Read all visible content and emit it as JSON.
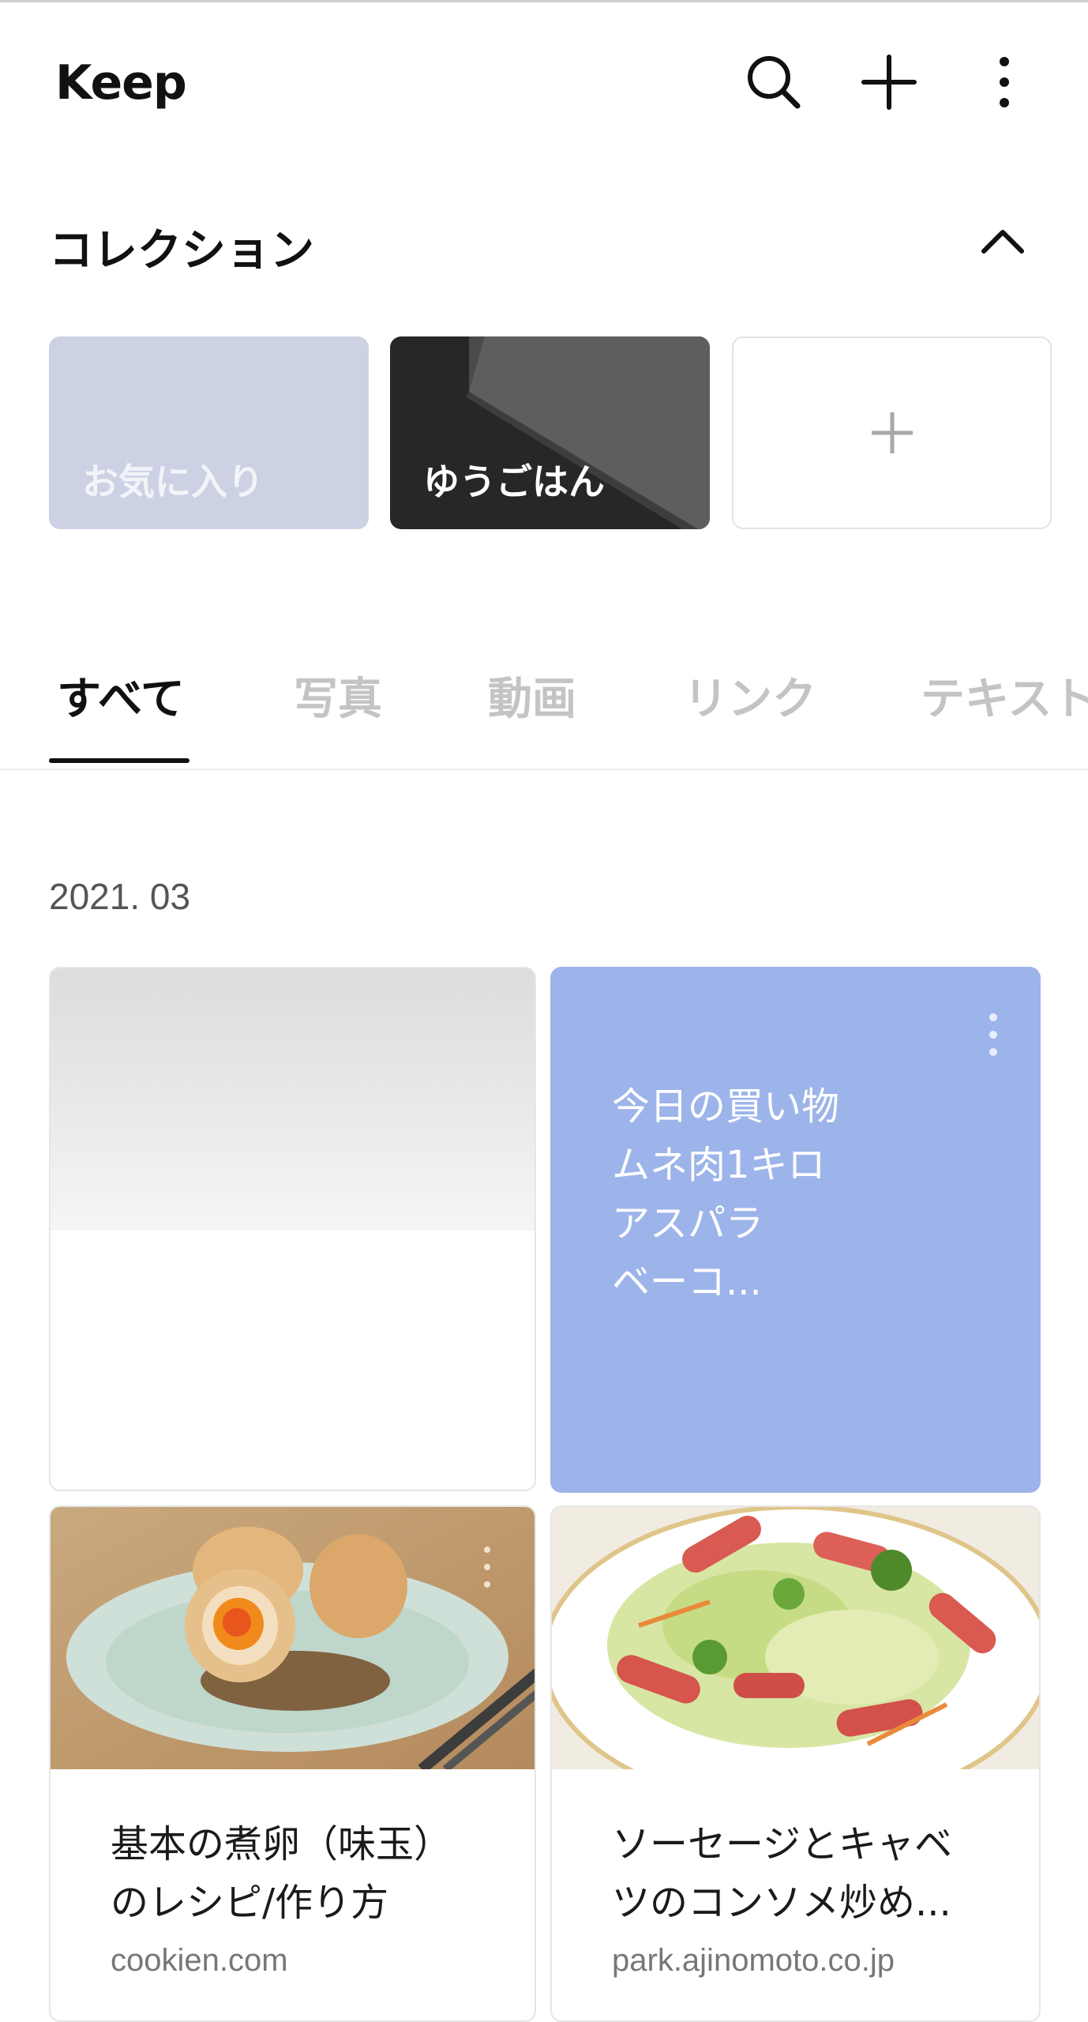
{
  "header": {
    "title": "Keep",
    "icons": [
      "search-icon",
      "add-icon",
      "more-vert-icon"
    ]
  },
  "collection": {
    "title": "コレクション",
    "collapse_icon": "chevron-up-icon",
    "items": [
      {
        "label": "お気に入り",
        "color": "#ccd2e3"
      },
      {
        "label": "ゆうごはん",
        "color": "#272727"
      }
    ],
    "add_icon": "plus-icon"
  },
  "tabs": [
    {
      "label": "すべて",
      "active": true
    },
    {
      "label": "写真"
    },
    {
      "label": "動画"
    },
    {
      "label": "リンク"
    },
    {
      "label": "テキスト"
    }
  ],
  "content": {
    "date": "2021. 03",
    "memo": {
      "lines": [
        "今日の買い物",
        "ムネ肉1キロ",
        "アスパラ",
        "ベーコ..."
      ],
      "color": "#9db4ea"
    },
    "links": [
      {
        "title_lines": [
          "基本の煮卵（味玉）",
          "のレシピ/作り方"
        ],
        "domain": "cookien.com"
      },
      {
        "title_lines": [
          "ソーセージとキャベ",
          "ツのコンソメ炒め..."
        ],
        "domain": "park.ajinomoto.co.jp"
      }
    ]
  }
}
